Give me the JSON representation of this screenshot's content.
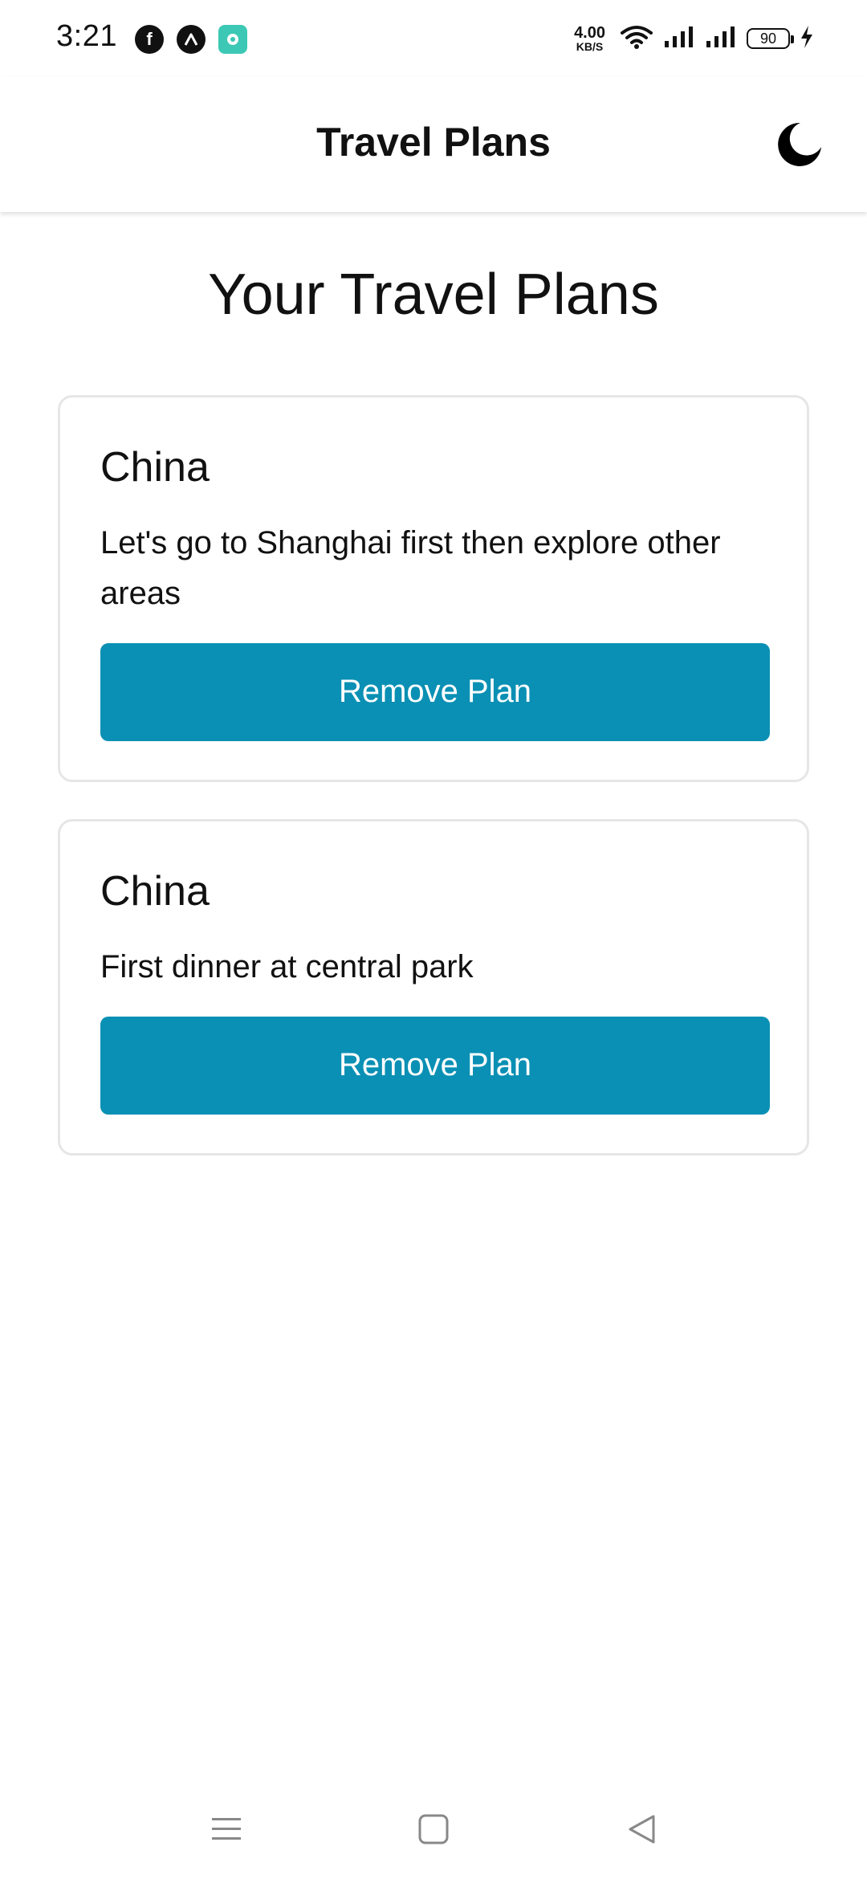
{
  "status_bar": {
    "time": "3:21",
    "apps": [
      "facebook-icon",
      "vpn-icon",
      "chat-app-icon"
    ],
    "net_speed_value": "4.00",
    "net_speed_unit": "KB/S",
    "battery_level": "90"
  },
  "app_bar": {
    "title": "Travel Plans",
    "theme_icon": "moon-icon"
  },
  "main": {
    "heading": "Your Travel Plans",
    "plans": [
      {
        "title": "China",
        "description": "Let's go to Shanghai first then explore other areas",
        "remove_label": "Remove Plan"
      },
      {
        "title": "China",
        "description": "First dinner at central park",
        "remove_label": "Remove Plan"
      }
    ]
  },
  "colors": {
    "accent": "#0a90b4",
    "card_border": "#e6e6e6"
  },
  "nav_bar": {
    "buttons": [
      "menu-icon",
      "home-icon",
      "back-icon"
    ]
  }
}
